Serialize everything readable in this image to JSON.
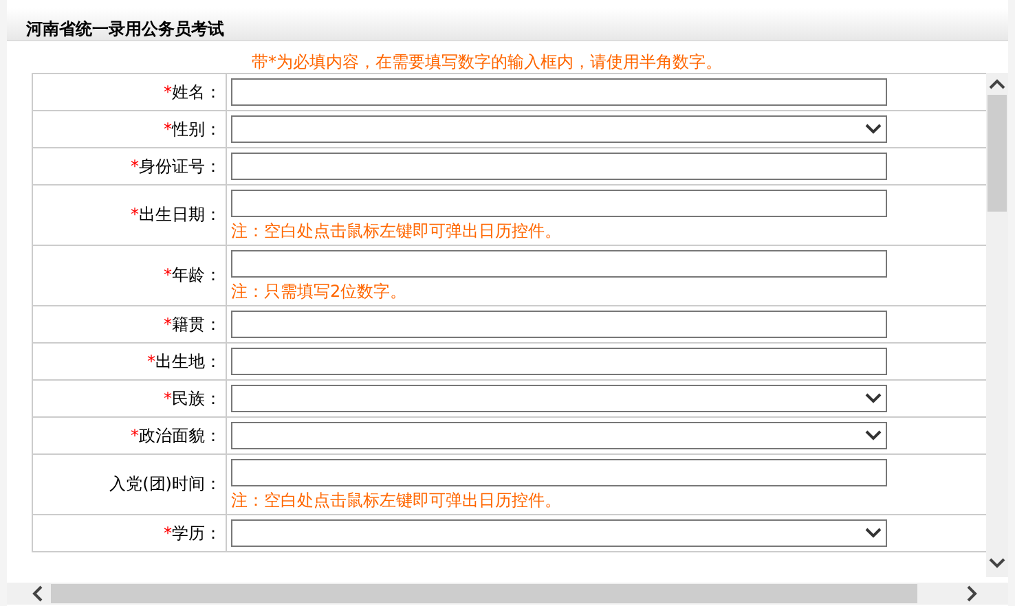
{
  "window": {
    "title": "河南省统一录用公务员考试"
  },
  "notice": {
    "mark": "带*",
    "text": "为必填内容，在需要填写数字的输入框内，请使用半角数字。"
  },
  "fields": [
    {
      "marker": "*",
      "label": "姓名：",
      "kind": "text"
    },
    {
      "marker": "*",
      "label": "性别：",
      "kind": "select"
    },
    {
      "marker": "*",
      "label": "身份证号：",
      "kind": "text"
    },
    {
      "marker": "*",
      "label": "出生日期：",
      "kind": "text",
      "note": "注：空白处点击鼠标左键即可弹出日历控件。"
    },
    {
      "marker": "*",
      "label": "年龄：",
      "kind": "text",
      "note": "注：只需填写2位数字。"
    },
    {
      "marker": "*",
      "label": "籍贯：",
      "kind": "text"
    },
    {
      "marker": "*",
      "label": "出生地：",
      "kind": "text"
    },
    {
      "marker": "*",
      "label": "民族：",
      "kind": "select"
    },
    {
      "marker": "*",
      "label": "政治面貌：",
      "kind": "select"
    },
    {
      "label": "入党(团)时间：",
      "kind": "text",
      "note": "注：空白处点击鼠标左键即可弹出日历控件。"
    },
    {
      "marker": "*",
      "label": "学历：",
      "kind": "select"
    }
  ]
}
